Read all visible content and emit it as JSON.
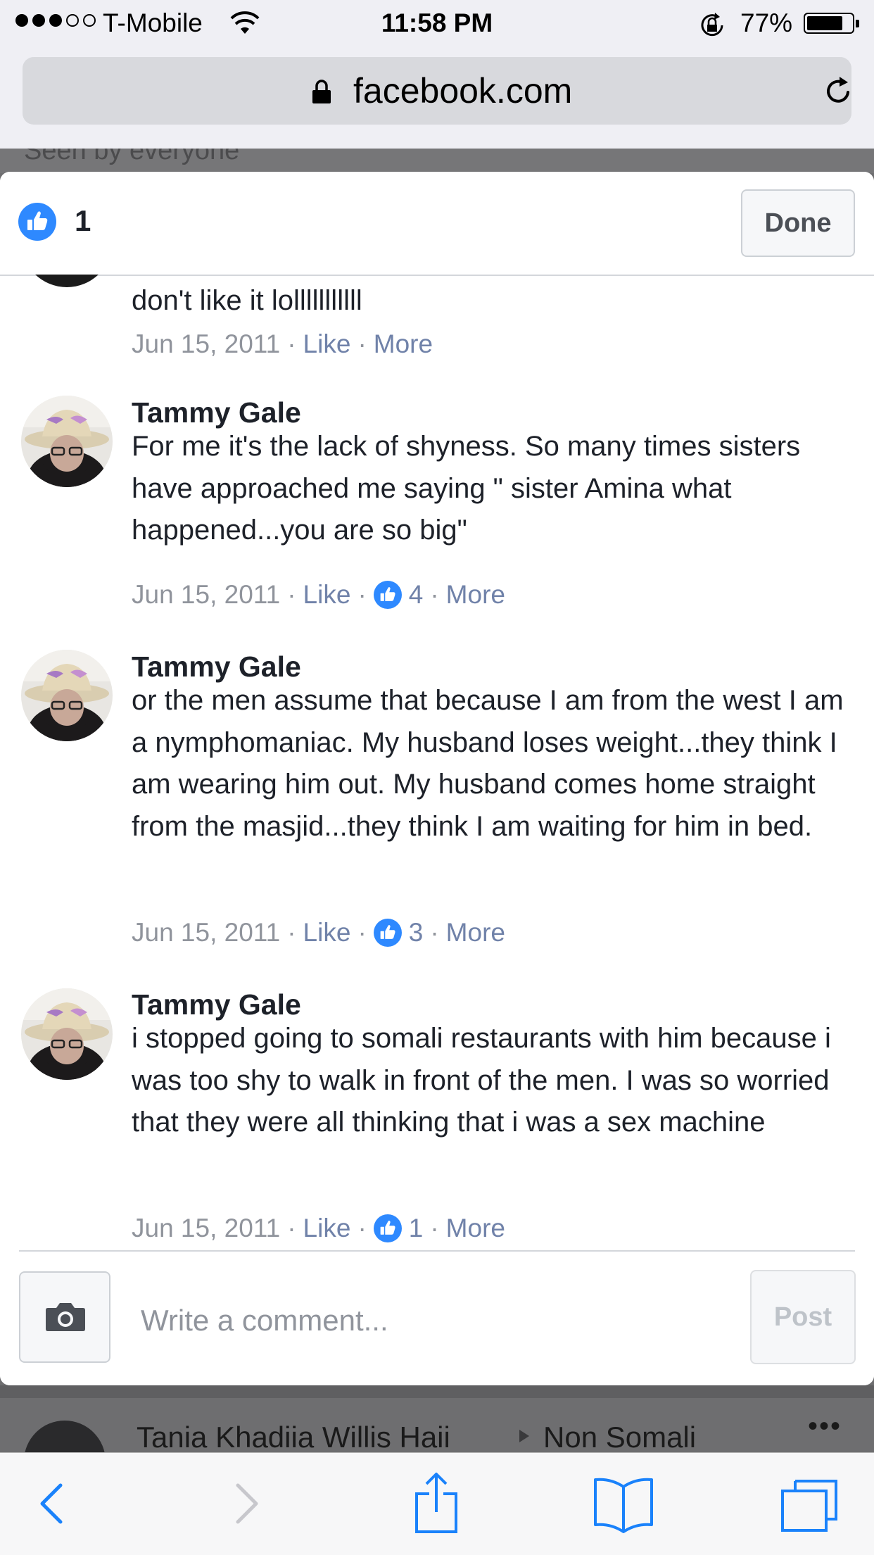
{
  "status_bar": {
    "carrier": "T-Mobile",
    "time": "11:58 PM",
    "battery": "77%",
    "battery_level": 0.77
  },
  "url_bar": {
    "domain": "facebook.com"
  },
  "background": {
    "peek_text": "Seen by everyone",
    "post_author": "Tania Khadiia Willis Haii",
    "post_group": "Non Somali",
    "more_label": "•••"
  },
  "modal": {
    "likes_count": "1",
    "done_label": "Done",
    "comments": [
      {
        "text": "don't like it lolllllllllll",
        "date": "Jun 15, 2011",
        "like_label": "Like",
        "more_label": "More"
      },
      {
        "name": "Tammy Gale",
        "text": "For me it's the lack of shyness. So many times sisters have approached me saying \" sister Amina what happened...you are so big\"",
        "date": "Jun 15, 2011",
        "like_label": "Like",
        "reactions": "4",
        "more_label": "More"
      },
      {
        "name": "Tammy Gale",
        "text": "or the men assume that because I am from the west I am a nymphomaniac. My husband loses weight...they think I am wearing him out. My husband comes home straight from the masjid...they think I am waiting for him in bed.",
        "date": "Jun 15, 2011",
        "like_label": "Like",
        "reactions": "3",
        "more_label": "More"
      },
      {
        "name": "Tammy Gale",
        "text": "i stopped going to somali restaurants with him because i was too shy to walk in front of the men. I was so worried that they were all thinking that i was a sex machine",
        "date": "Jun 15, 2011",
        "like_label": "Like",
        "reactions": "1",
        "more_label": "More"
      }
    ],
    "comment_placeholder": "Write a comment...",
    "post_label": "Post"
  },
  "colors": {
    "like_blue": "#2e89ff",
    "ios_blue": "#1a82fb",
    "meta_gray": "#90949c",
    "link_gray": "#7082a9"
  },
  "toolbar": {
    "icons": [
      "back-icon",
      "forward-icon",
      "share-icon",
      "bookmarks-icon",
      "tabs-icon"
    ]
  }
}
